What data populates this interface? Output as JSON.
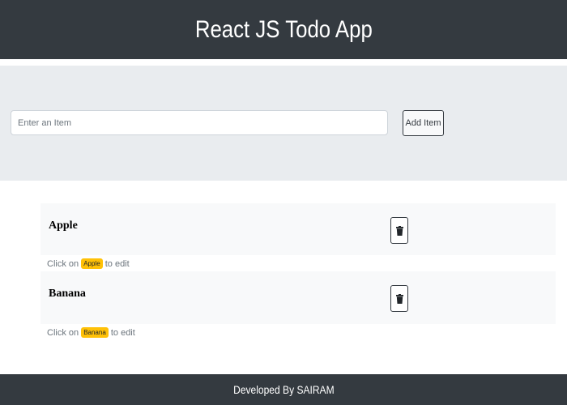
{
  "header": {
    "title": "React JS Todo App"
  },
  "form": {
    "placeholder": "Enter an Item",
    "value": "",
    "add_label": "Add Item"
  },
  "todos": [
    {
      "name": "Apple",
      "hint_prefix": "Click on",
      "hint_suffix": "to edit",
      "delete_icon": "trash-icon"
    },
    {
      "name": "Banana",
      "hint_prefix": "Click on",
      "hint_suffix": "to edit",
      "delete_icon": "trash-icon"
    }
  ],
  "footer": {
    "text": "Developed By SAIRAM"
  },
  "colors": {
    "header_bg": "#343a40",
    "jumbotron_bg": "#e9ecef",
    "row_bg": "#f8f9fa",
    "badge_bg": "#ffc107"
  }
}
